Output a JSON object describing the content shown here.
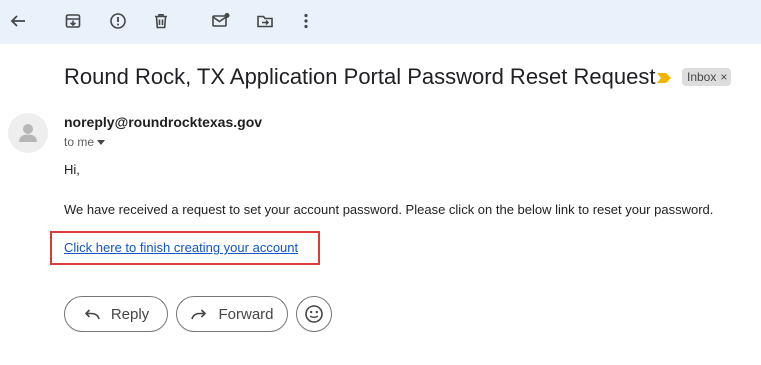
{
  "toolbar": {
    "icons": [
      "back-arrow-icon",
      "archive-icon",
      "report-spam-icon",
      "delete-icon",
      "mark-unread-icon",
      "move-to-icon",
      "more-options-icon"
    ]
  },
  "email": {
    "subject": "Round Rock, TX Application Portal Password Reset Request",
    "label": "Inbox",
    "label_close": "×",
    "sender": "noreply@roundrocktexas.gov",
    "recipient": "to me",
    "greeting": "Hi,",
    "body": "We have received a request to set your account password. Please click on the below link to reset your password.",
    "link_text": "Click here to finish creating your account"
  },
  "actions": {
    "reply_label": "Reply",
    "forward_label": "Forward"
  },
  "colors": {
    "toolbar_bg": "#eaf1fb",
    "link": "#1155cc",
    "highlight_box": "#e0393a",
    "importance_marker": "#f2b400"
  }
}
